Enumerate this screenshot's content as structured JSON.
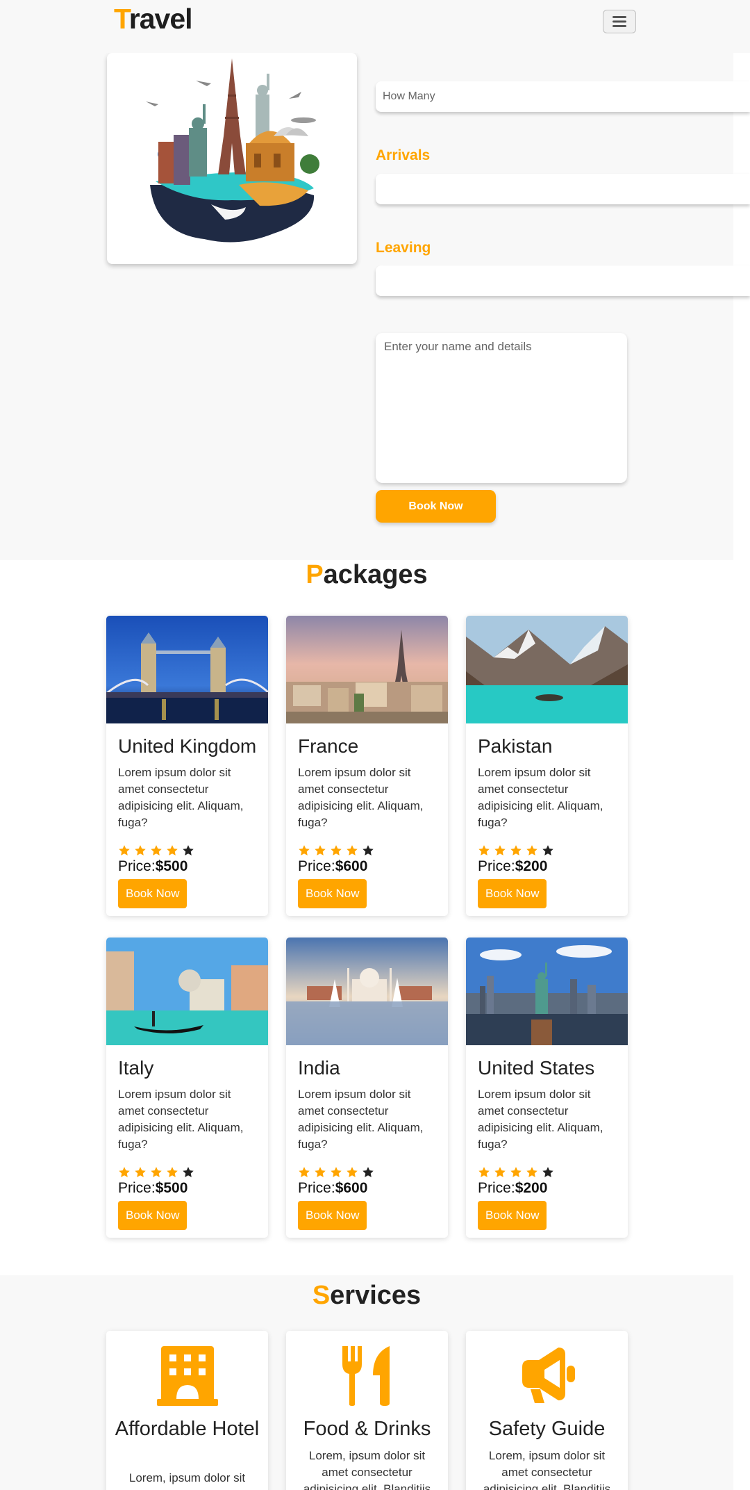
{
  "brand": {
    "first_letter": "T",
    "rest": "ravel"
  },
  "navbar": {
    "toggler_icon": "hamburger-icon"
  },
  "booking": {
    "how_many_placeholder": "How Many",
    "arrivals_label": "Arrivals",
    "leaving_label": "Leaving",
    "details_placeholder": "Enter your name and details",
    "book_button": "Book Now"
  },
  "packages": {
    "title_first": "P",
    "title_rest": "ackages",
    "items": [
      {
        "name": "United Kingdom",
        "text": "Lorem ipsum dolor sit amet consectetur adipisicing elit. Aliquam, fuga?",
        "rating": 4,
        "price_label": "Price:",
        "price": "$500",
        "button": "Book Now",
        "image": "tower-bridge"
      },
      {
        "name": "France",
        "text": "Lorem ipsum dolor sit amet consectetur adipisicing elit. Aliquam, fuga?",
        "rating": 4,
        "price_label": "Price:",
        "price": "$600",
        "button": "Book Now",
        "image": "eiffel-tower"
      },
      {
        "name": "Pakistan",
        "text": "Lorem ipsum dolor sit amet consectetur adipisicing elit. Aliquam, fuga?",
        "rating": 4,
        "price_label": "Price:",
        "price": "$200",
        "button": "Book Now",
        "image": "mountain-lake"
      },
      {
        "name": "Italy",
        "text": "Lorem ipsum dolor sit amet consectetur adipisicing elit. Aliquam, fuga?",
        "rating": 4,
        "price_label": "Price:",
        "price": "$500",
        "button": "Book Now",
        "image": "venice-gondola"
      },
      {
        "name": "India",
        "text": "Lorem ipsum dolor sit amet consectetur adipisicing elit. Aliquam, fuga?",
        "rating": 4,
        "price_label": "Price:",
        "price": "$600",
        "button": "Book Now",
        "image": "taj-mahal"
      },
      {
        "name": "United States",
        "text": "Lorem ipsum dolor sit amet consectetur adipisicing elit. Aliquam, fuga?",
        "rating": 4,
        "price_label": "Price:",
        "price": "$200",
        "button": "Book Now",
        "image": "statue-of-liberty"
      }
    ]
  },
  "services": {
    "title_first": "S",
    "title_rest": "ervices",
    "items": [
      {
        "title": "Affordable Hotel",
        "text": "Lorem, ipsum dolor sit",
        "icon": "hotel-icon"
      },
      {
        "title": "Food & Drinks",
        "text": "Lorem, ipsum dolor sit amet consectetur adipisicing elit. Blanditiis",
        "icon": "utensils-icon"
      },
      {
        "title": "Safety Guide",
        "text": "Lorem, ipsum dolor sit amet consectetur adipisicing elit. Blanditiis",
        "icon": "megaphone-icon"
      }
    ]
  },
  "colors": {
    "accent": "#ffa500",
    "section_bg": "#f8f8f8",
    "text": "#222222"
  }
}
